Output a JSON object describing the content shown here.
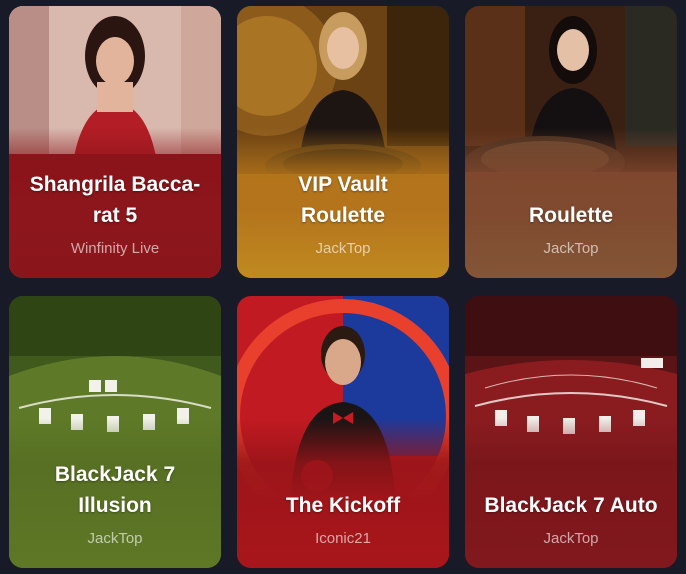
{
  "games": [
    {
      "title": "Shangrila Bacca-rat 5",
      "title_line1": "Shangrila Bacca-",
      "title_line2": "rat 5",
      "provider": "Winfinity Live",
      "accent": "#8a151b"
    },
    {
      "title": "VIP Vault Roulette",
      "title_line1": "VIP Vault",
      "title_line2": "Roulette",
      "provider": "JackTop",
      "accent": "#c08a20"
    },
    {
      "title": "Roulette",
      "title_line1": "Roulette",
      "title_line2": "",
      "provider": "JackTop",
      "accent": "#845536"
    },
    {
      "title": "BlackJack 7 Illusion",
      "title_line1": "BlackJack 7",
      "title_line2": "Illusion",
      "provider": "JackTop",
      "accent": "#5e7826"
    },
    {
      "title": "The Kickoff",
      "title_line1": "The Kickoff",
      "title_line2": "",
      "provider": "Iconic21",
      "accent": "#a8161b"
    },
    {
      "title": "BlackJack 7 Auto",
      "title_line1": "BlackJack 7 Auto",
      "title_line2": "",
      "provider": "JackTop",
      "accent": "#80181d"
    }
  ],
  "colors": {
    "background": "#181a27",
    "title_text": "#ffffff",
    "provider_text": "#c9c9cc"
  }
}
